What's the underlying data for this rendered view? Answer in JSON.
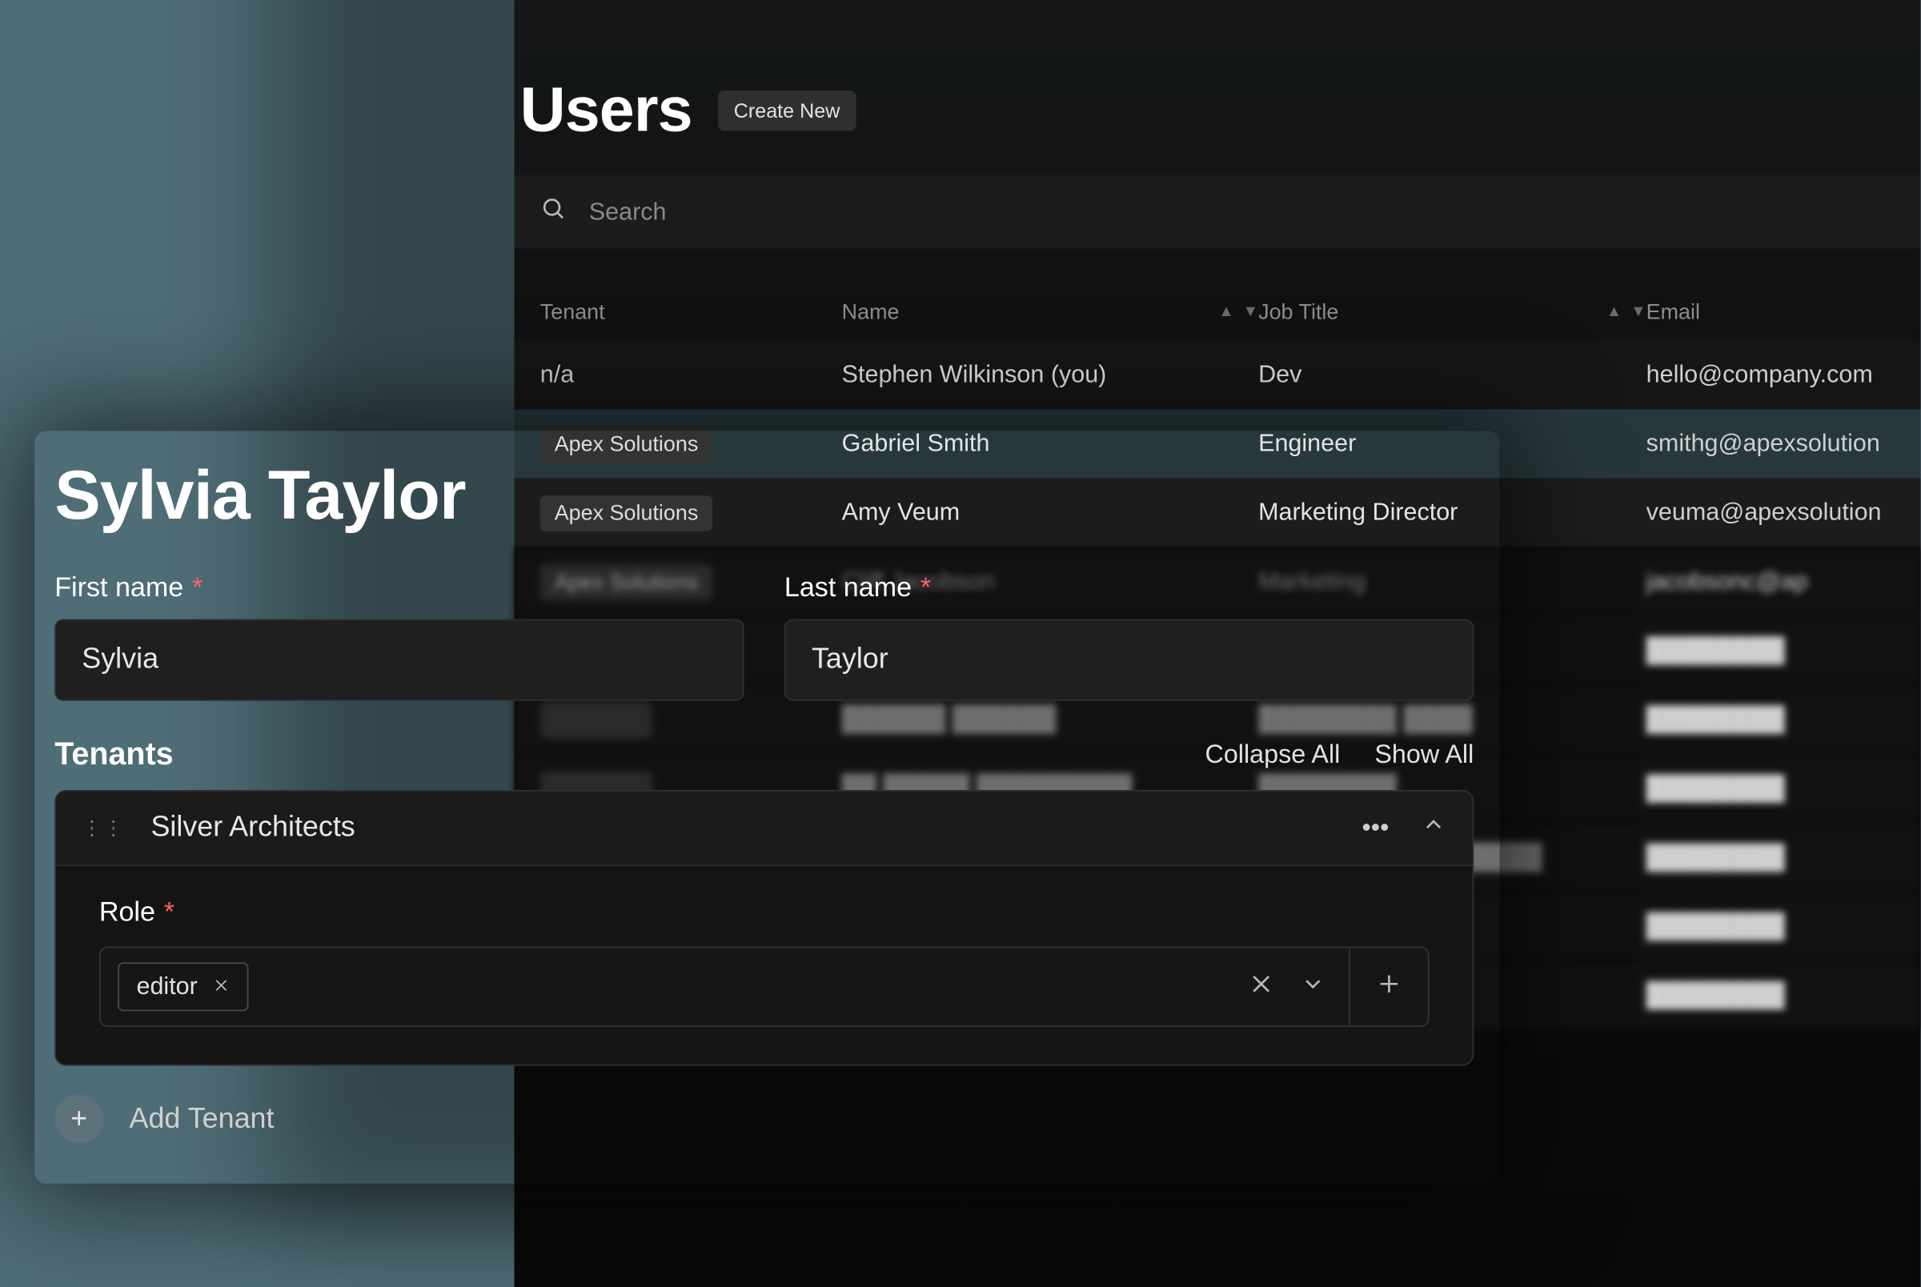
{
  "users": {
    "title": "Users",
    "create_new_label": "Create New",
    "search_placeholder": "Search"
  },
  "columns": {
    "tenant": "Tenant",
    "name": "Name",
    "job_title": "Job Title",
    "email": "Email"
  },
  "rows": [
    {
      "tenant": "n/a",
      "tenant_plain": true,
      "name": "Stephen Wilkinson (you)",
      "job": "Dev",
      "email": "hello@company.com"
    },
    {
      "tenant": "Apex Solutions",
      "tenant_plain": false,
      "name": "Gabriel Smith",
      "job": "Engineer",
      "email": "smithg@apexsolution"
    },
    {
      "tenant": "Apex Solutions",
      "tenant_plain": false,
      "name": "Amy Veum",
      "job": "Marketing Director",
      "email": "veuma@apexsolution"
    },
    {
      "tenant": "Apex Solutions",
      "tenant_plain": false,
      "name": "Cliff Jacobson",
      "job": "Marketing",
      "email": "jacobsonc@ap"
    }
  ],
  "edit": {
    "full_name": "Sylvia Taylor",
    "first_name_label": "First name",
    "last_name_label": "Last name",
    "first_name": "Sylvia",
    "last_name": "Taylor",
    "tenants_heading": "Tenants",
    "collapse_all": "Collapse All",
    "show_all": "Show All",
    "card_tenant_name": "Silver Architects",
    "role_label": "Role",
    "role_tag": "editor",
    "add_tenant_label": "Add Tenant"
  }
}
